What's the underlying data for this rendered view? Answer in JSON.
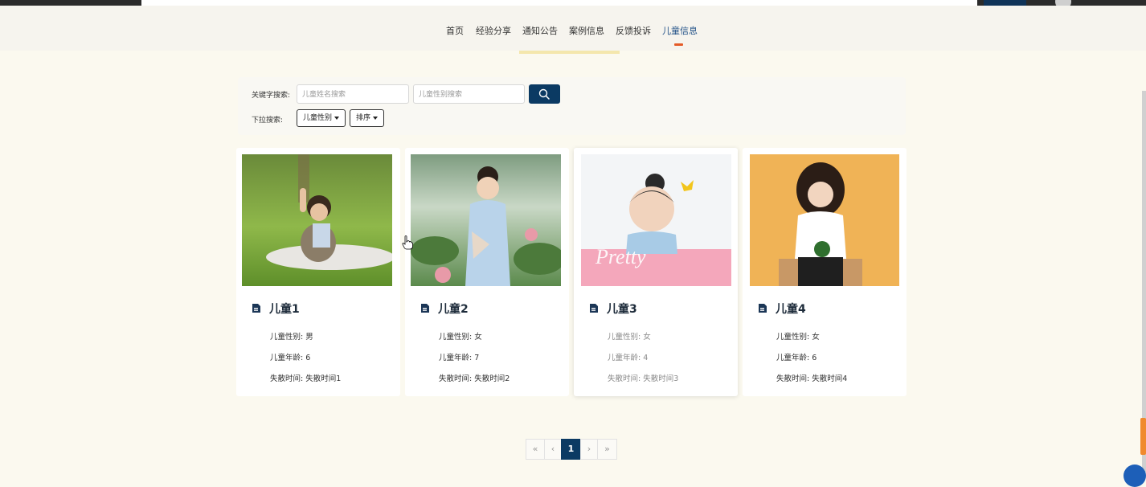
{
  "nav": {
    "items": [
      "首页",
      "经验分享",
      "通知公告",
      "案例信息",
      "反馈投诉",
      "儿童信息"
    ],
    "active_index": 5
  },
  "search": {
    "keyword_label": "关键字搜索:",
    "name_placeholder": "儿童姓名搜索",
    "gender_placeholder": "儿童性别搜索",
    "dropdown_label": "下拉搜索:",
    "dropdown_gender": "儿童性别",
    "dropdown_sort": "排序"
  },
  "cards": [
    {
      "title": "儿童1",
      "gender": "儿童性别: 男",
      "age": "儿童年龄: 6",
      "lost_time": "失散时间: 失散时间1"
    },
    {
      "title": "儿童2",
      "gender": "儿童性别: 女",
      "age": "儿童年龄: 7",
      "lost_time": "失散时间: 失散时间2"
    },
    {
      "title": "儿童3",
      "gender": "儿童性别: 女",
      "age": "儿童年龄: 4",
      "lost_time": "失散时间: 失散时间3"
    },
    {
      "title": "儿童4",
      "gender": "儿童性别: 女",
      "age": "儿童年龄: 6",
      "lost_time": "失散时间: 失散时间4"
    }
  ],
  "pagination": {
    "first": "«",
    "prev": "‹",
    "current": "1",
    "next": "›",
    "last": "»"
  },
  "colors": {
    "accent": "#0b3a63",
    "nav_active": "#1f4f86",
    "underline": "#e45b28",
    "background": "#fbf9ef"
  },
  "icons": [
    "search-icon",
    "document-icon",
    "help-icon"
  ]
}
